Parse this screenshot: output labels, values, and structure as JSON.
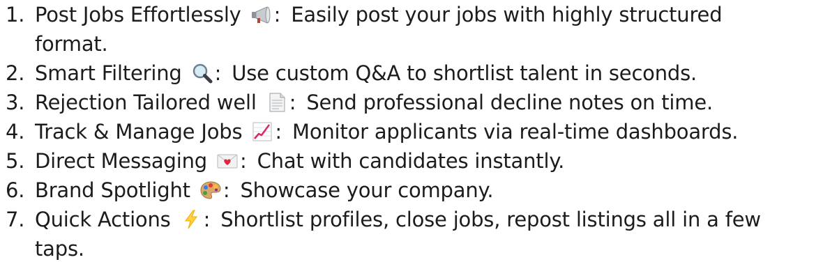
{
  "features": [
    {
      "number": "1.",
      "title": "Post Jobs Effortlessly",
      "icon": "megaphone-icon",
      "description": "Easily post your jobs with highly structured format."
    },
    {
      "number": "2.",
      "title": "Smart Filtering",
      "icon": "magnifier-icon",
      "description": "Use custom Q&A to shortlist talent in seconds."
    },
    {
      "number": "3.",
      "title": "Rejection Tailored well",
      "icon": "document-icon",
      "description": "Send professional decline notes on time."
    },
    {
      "number": "4.",
      "title": "Track & Manage Jobs",
      "icon": "chart-increasing-icon",
      "description": "Monitor applicants via real-time dashboards."
    },
    {
      "number": "5.",
      "title": "Direct Messaging",
      "icon": "love-letter-icon",
      "description": "Chat with candidates instantly."
    },
    {
      "number": "6.",
      "title": "Brand Spotlight",
      "icon": "palette-icon",
      "description": "Showcase your company."
    },
    {
      "number": "7.",
      "title": "Quick Actions",
      "icon": "lightning-icon",
      "description": "Shortlist profiles, close jobs, repost listings all in a few taps."
    }
  ],
  "separator": ":"
}
